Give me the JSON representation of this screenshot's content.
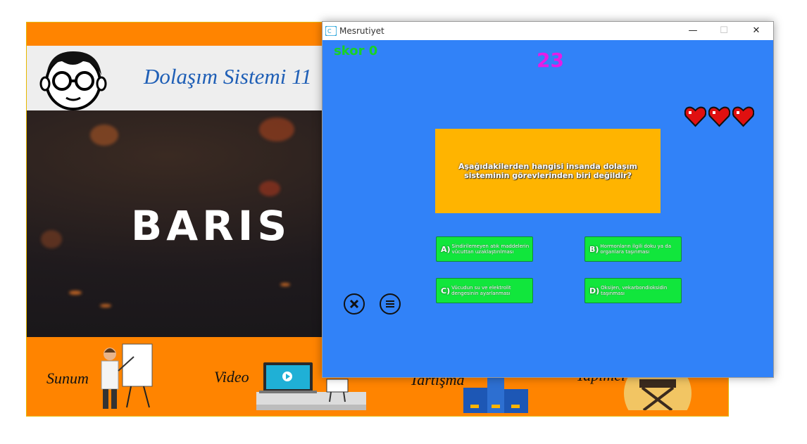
{
  "background_app": {
    "title": "Dolaşım Sistemi 11",
    "hero_text": "BARIS",
    "footer_items": [
      {
        "label": "Sunum"
      },
      {
        "label": "Video"
      },
      {
        "label": "Tartışma"
      },
      {
        "label": "Yapımcı"
      }
    ]
  },
  "game_window": {
    "title": "Mesrutiyet",
    "controls": {
      "minimize": "—",
      "maximize": "☐",
      "close": "✕"
    },
    "score_label": "skor 0",
    "timer": "23",
    "lives": 3,
    "question": "Aşağıdakilerden hangisi insanda dolaşım sisteminin görevlerinden biri değildir?",
    "answers": [
      {
        "letter": "A)",
        "text": "Sindirilemeyen atık maddelerin vücuttan uzaklaştırılması"
      },
      {
        "letter": "B)",
        "text": "Hormonların ilgili doku ya da organlara taşınması"
      },
      {
        "letter": "C)",
        "text": "Vücudun su ve elektrolit dengesinin ayarlanması"
      },
      {
        "letter": "D)",
        "text": "Oksijen, vekarbondioksidin taşınması"
      }
    ],
    "colors": {
      "background": "#3182f8",
      "question_box": "#ffb400",
      "answer": "#11e63c",
      "score": "#19d126",
      "timer": "#e61be6",
      "heart": "#e01010"
    },
    "buttons": {
      "close_icon": "x-circle-icon",
      "menu_icon": "menu-circle-icon"
    }
  }
}
